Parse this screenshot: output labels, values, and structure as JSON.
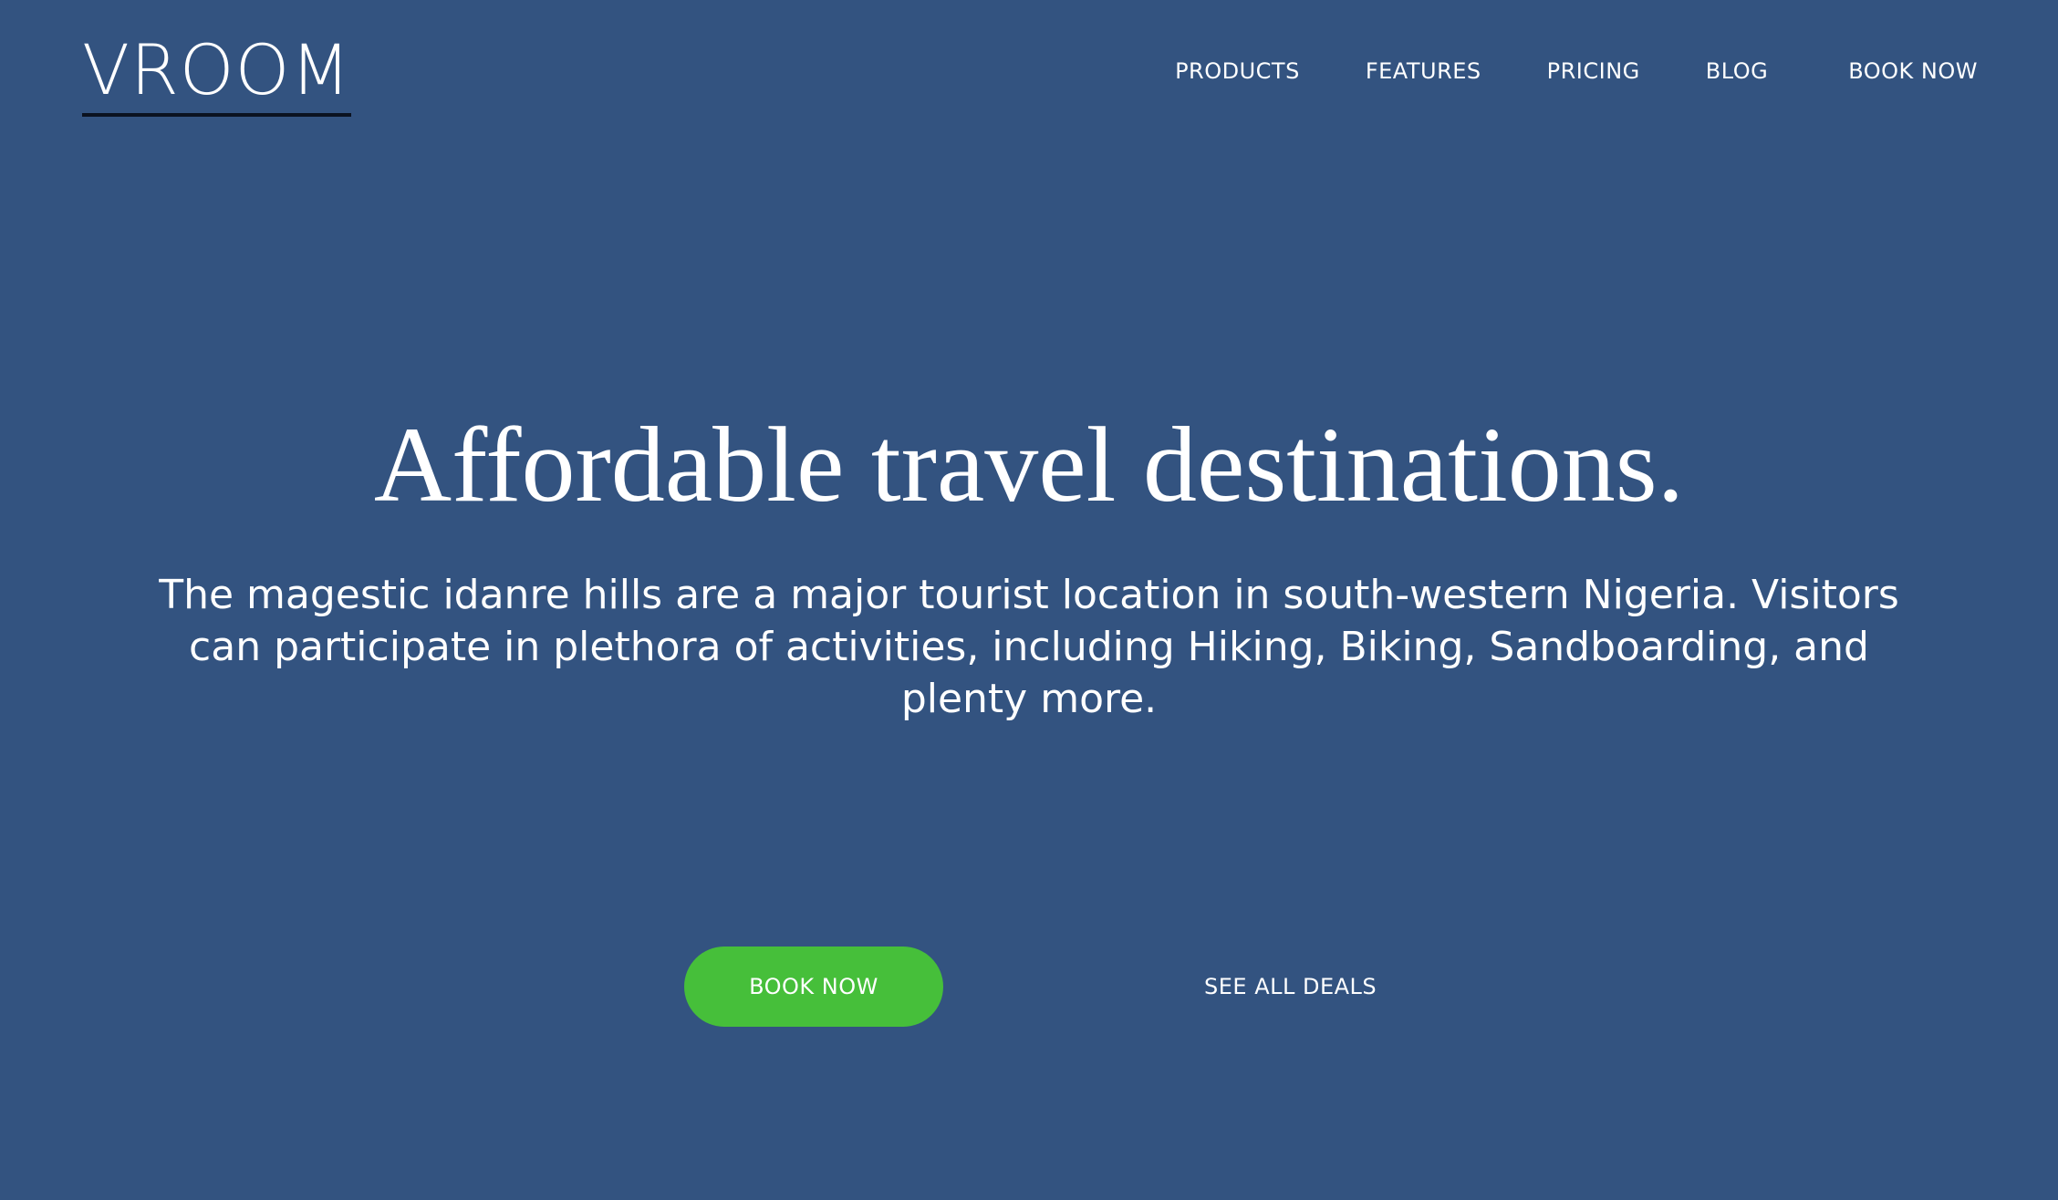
{
  "colors": {
    "background": "#335380",
    "text": "#ffffff",
    "accent": "#46bf3a",
    "logo_underline": "#0b1220"
  },
  "header": {
    "logo": "VROOM",
    "nav": {
      "products": "PRODUCTS",
      "features": "FEATURES",
      "pricing": "PRICING",
      "blog": "BLOG",
      "book_now": "BOOK NOW"
    }
  },
  "hero": {
    "title": "Affordable travel destinations.",
    "description": "The magestic idanre hills are a major tourist location in south-western Nigeria. Visitors can participate in plethora of activities, including Hiking, Biking, Sandboarding, and plenty more."
  },
  "cta": {
    "book_now": "BOOK NOW",
    "see_all_deals": "SEE ALL DEALS"
  }
}
